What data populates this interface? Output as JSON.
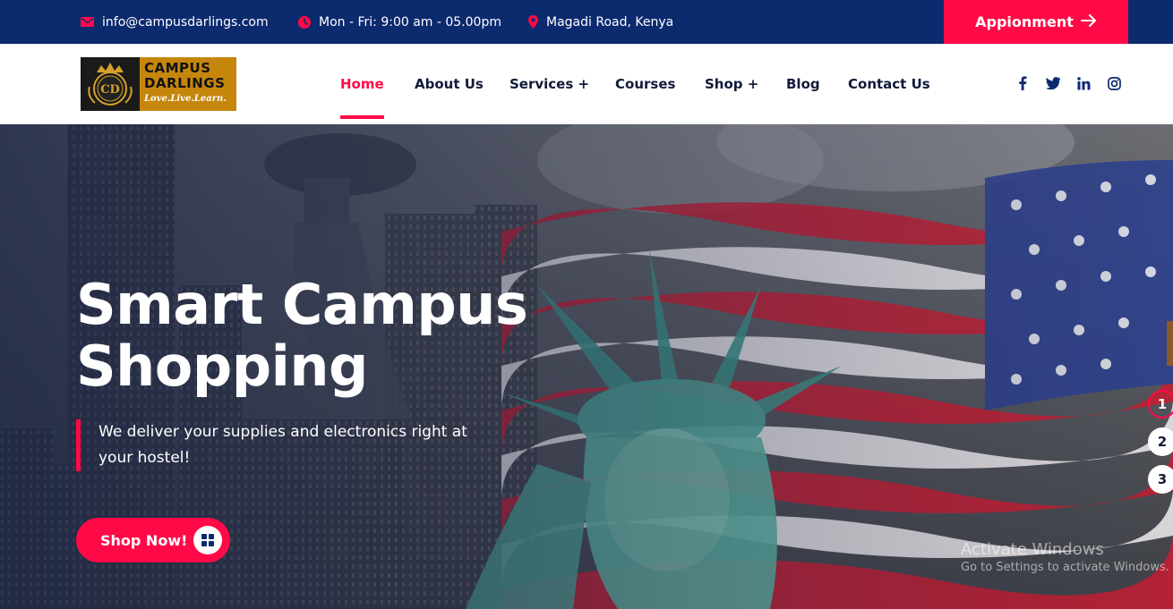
{
  "topbar": {
    "email": "info@campusdarlings.com",
    "email_icon": "envelope-icon",
    "hours": "Mon - Fri: 9:00 am - 05.00pm",
    "hours_icon": "clock-icon",
    "address": "Magadi Road, Kenya",
    "address_icon": "map-pin-icon",
    "appointment_label": "Appionment",
    "appointment_icon": "arrow-right-icon"
  },
  "logo": {
    "line1": "CAMPUS",
    "line2": "DARLINGS",
    "tagline": "Love.Live.Learn.",
    "monogram": "CD"
  },
  "nav": {
    "items": [
      {
        "label": "Home",
        "active": true
      },
      {
        "label": "About Us"
      },
      {
        "label": "Services +"
      },
      {
        "label": "Courses"
      },
      {
        "label": "Shop +"
      },
      {
        "label": "Blog"
      },
      {
        "label": "Contact Us"
      }
    ]
  },
  "social": [
    "facebook-icon",
    "twitter-icon",
    "linkedin-icon",
    "instagram-icon"
  ],
  "hero": {
    "title_line1": "Smart Campus",
    "title_line2": "Shopping",
    "subtitle": "We deliver your supplies and electronics right at your hostel!",
    "button_label": "Shop Now!",
    "button_icon": "grid-icon",
    "slides": [
      "1",
      "2",
      "3"
    ]
  },
  "watermark": {
    "line1": "Activate Windows",
    "line2": "Go to Settings to activate Windows."
  },
  "colors": {
    "navy": "#0c2a6e",
    "accent": "#ff0a47",
    "logo_gold": "#c6860c"
  }
}
